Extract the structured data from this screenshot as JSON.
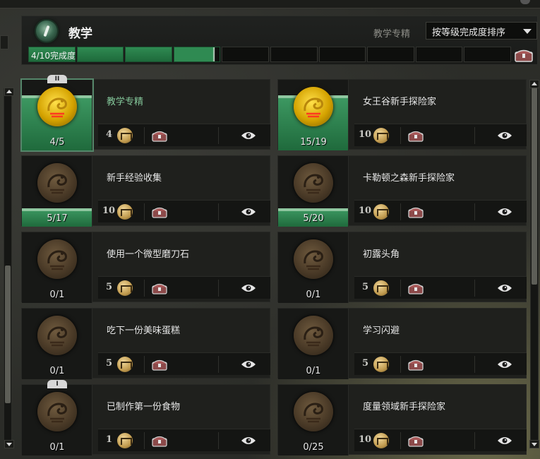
{
  "header": {
    "title": "教学",
    "filter_label": "教学专精",
    "sort_value": "按等级完成度排序",
    "progress_text": "4/10完成度",
    "progress_total_segments": 10,
    "progress_completed": 4
  },
  "icons": {
    "category": "trumpet-icon",
    "chest": "chest-icon",
    "eye": "eye-icon",
    "ap": "achievement-points-icon"
  },
  "colors": {
    "accent_green": "#2f8a52",
    "title_green": "#84c79a",
    "gold_emblem": "#f0c020"
  },
  "achievements": [
    {
      "title": "教学专精",
      "progress": "4/5",
      "points": "4",
      "fill": 1.0,
      "gold": true,
      "selected": true,
      "tier": "II",
      "title_green": true
    },
    {
      "title": "女王谷新手探险家",
      "progress": "15/19",
      "points": "10",
      "fill": 1.0,
      "gold": true,
      "selected": false,
      "tier": "",
      "title_green": false
    },
    {
      "title": "新手经验收集",
      "progress": "5/17",
      "points": "10",
      "fill": 0.29,
      "gold": false,
      "selected": false,
      "tier": "",
      "title_green": false
    },
    {
      "title": "卡勒顿之森新手探险家",
      "progress": "5/20",
      "points": "10",
      "fill": 0.25,
      "gold": false,
      "selected": false,
      "tier": "",
      "title_green": false
    },
    {
      "title": "使用一个微型磨刀石",
      "progress": "0/1",
      "points": "5",
      "fill": 0,
      "gold": false,
      "selected": false,
      "tier": "",
      "title_green": false
    },
    {
      "title": "初露头角",
      "progress": "0/1",
      "points": "5",
      "fill": 0,
      "gold": false,
      "selected": false,
      "tier": "",
      "title_green": false
    },
    {
      "title": "吃下一份美味蛋糕",
      "progress": "0/1",
      "points": "5",
      "fill": 0,
      "gold": false,
      "selected": false,
      "tier": "",
      "title_green": false
    },
    {
      "title": "学习闪避",
      "progress": "0/1",
      "points": "5",
      "fill": 0,
      "gold": false,
      "selected": false,
      "tier": "",
      "title_green": false
    },
    {
      "title": "已制作第一份食物",
      "progress": "0/1",
      "points": "1",
      "fill": 0,
      "gold": false,
      "selected": false,
      "tier": "I",
      "title_green": false
    },
    {
      "title": "度量领域新手探险家",
      "progress": "0/25",
      "points": "10",
      "fill": 0,
      "gold": false,
      "selected": false,
      "tier": "",
      "title_green": false
    }
  ]
}
